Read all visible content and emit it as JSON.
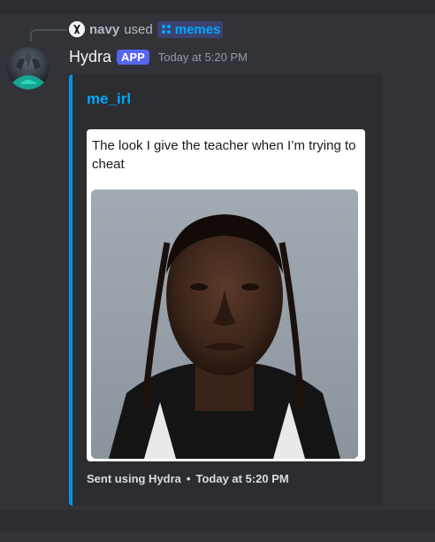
{
  "interaction": {
    "user": "navy",
    "used_text": "used",
    "command": "memes"
  },
  "message": {
    "author": "Hydra",
    "badge": "APP",
    "timestamp": "Today at 5:20 PM"
  },
  "embed": {
    "title": "me_irl",
    "caption": "The look I give the teacher when I’m trying to cheat",
    "footer_text": "Sent using Hydra",
    "footer_separator": "•",
    "footer_time": "Today at 5:20 PM",
    "accent_color": "#0a8fe8"
  },
  "icons": {
    "command_icon": "slash-command-icon",
    "mini_avatar": "user-avatar",
    "bot_avatar": "hydra-avatar",
    "meme_image": "meme-photo"
  }
}
